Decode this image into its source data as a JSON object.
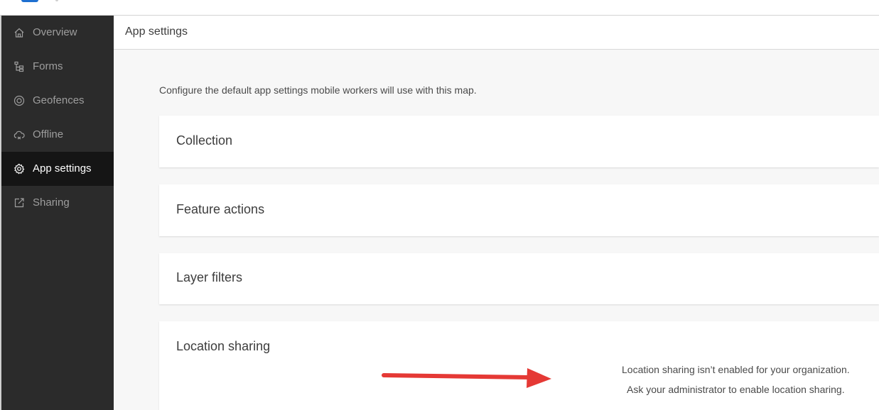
{
  "sidebar": {
    "items": [
      {
        "label": "Overview",
        "icon": "home-icon"
      },
      {
        "label": "Forms",
        "icon": "forms-tree-icon"
      },
      {
        "label": "Geofences",
        "icon": "geofence-icon"
      },
      {
        "label": "Offline",
        "icon": "cloud-offline-icon"
      },
      {
        "label": "App settings",
        "icon": "gear-icon",
        "active": true
      },
      {
        "label": "Sharing",
        "icon": "share-icon"
      }
    ]
  },
  "header": {
    "title": "App settings"
  },
  "main": {
    "description": "Configure the default app settings mobile workers will use with this map.",
    "sections": [
      {
        "title": "Collection"
      },
      {
        "title": "Feature actions"
      },
      {
        "title": "Layer filters"
      },
      {
        "title": "Location sharing"
      }
    ],
    "location_sharing": {
      "line1": "Location sharing isn’t enabled for your organization.",
      "line2": "Ask your administrator to enable location sharing."
    }
  },
  "colors": {
    "sidebar_bg": "#2b2b2b",
    "sidebar_active_bg": "#151515",
    "brand_blue": "#1e6fd0",
    "annotation_arrow": "#e53935"
  }
}
